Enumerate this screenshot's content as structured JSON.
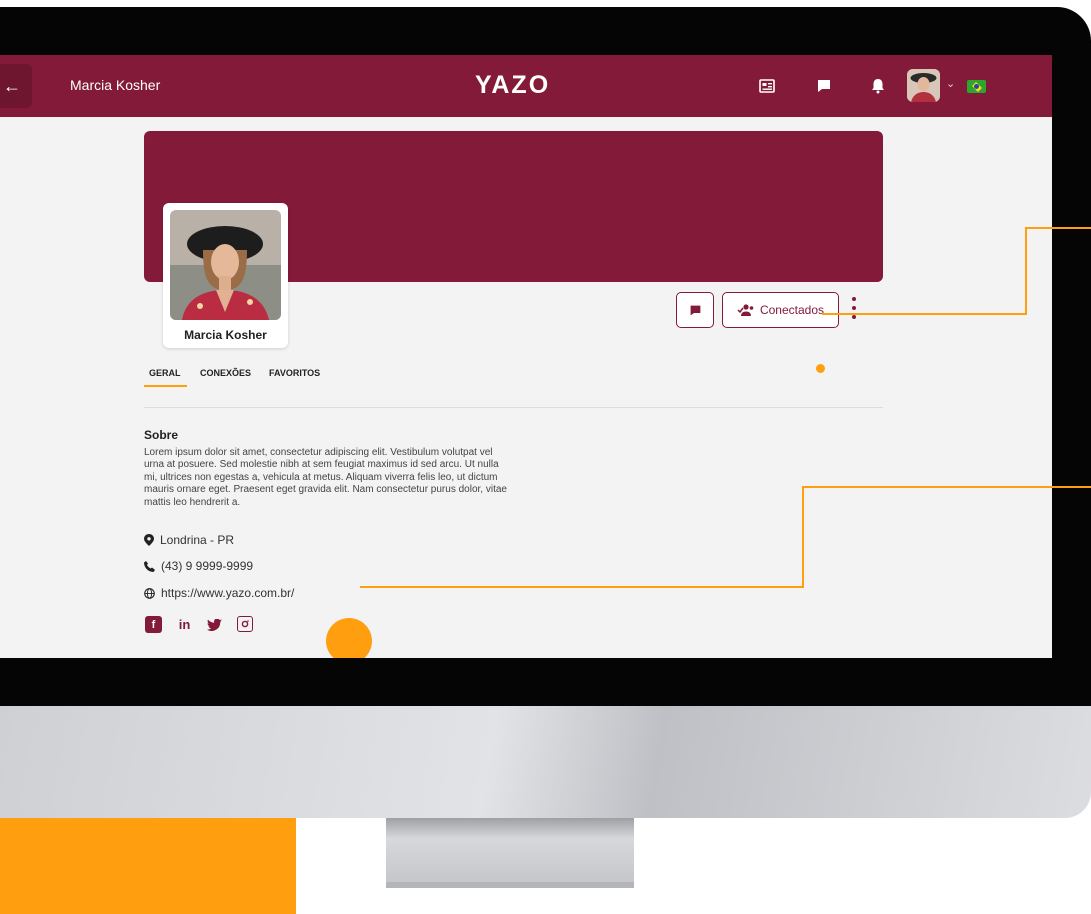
{
  "header": {
    "user_name": "Marcia Kosher",
    "logo": "YAZO",
    "icons": [
      "news-icon",
      "chat-icon",
      "bell-icon",
      "avatar",
      "chevron-down-icon",
      "brazil-flag-icon"
    ]
  },
  "profile": {
    "name": "Marcia Kosher",
    "buttons": {
      "connected_label": "Conectados"
    }
  },
  "tabs": [
    {
      "label": "GERAL",
      "active": true
    },
    {
      "label": "CONEXÕES",
      "active": false
    },
    {
      "label": "FAVORITOS",
      "active": false
    }
  ],
  "about": {
    "title": "Sobre",
    "text": "Lorem ipsum dolor sit amet, consectetur adipiscing elit. Vestibulum volutpat vel urna at posuere. Sed molestie nibh at sem feugiat maximus id sed arcu. Ut nulla mi, ultrices non egestas a, vehicula at metus. Aliquam viverra felis leo, ut dictum mauris ornare eget. Praesent eget gravida elit. Nam consectetur purus dolor, vitae mattis leo hendrerit a."
  },
  "contact": {
    "location": "Londrina - PR",
    "phone": "(43) 9 9999-9999",
    "website": "https://www.yazo.com.br/"
  },
  "social": [
    "facebook-icon",
    "linkedin-icon",
    "twitter-icon",
    "instagram-icon"
  ],
  "colors": {
    "brand": "#831a39",
    "accent": "#ff9f0f",
    "background": "#f3f3f4"
  }
}
